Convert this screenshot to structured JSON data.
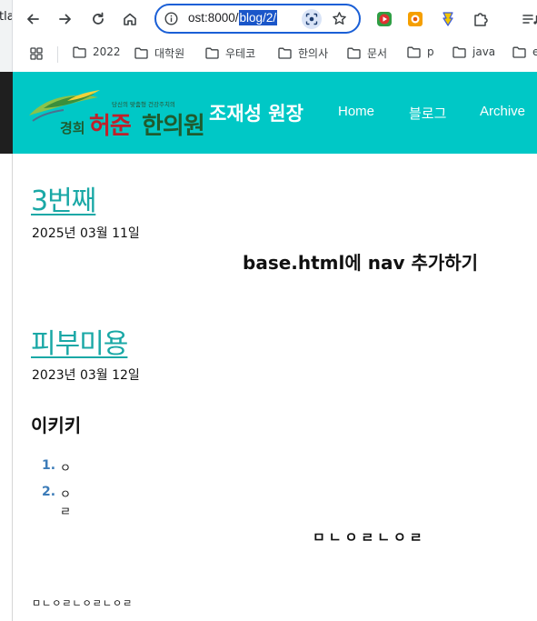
{
  "browser": {
    "tab_fragment": "tla",
    "url_visible": "ost:8000/",
    "url_selected": "blog/2/",
    "bookmarks": [
      "2022",
      "대학원",
      "우테코",
      "한의사",
      "문서",
      "p",
      "java",
      "e"
    ]
  },
  "header": {
    "logo": {
      "tagline": "당신의 맞춤형 건강주치의",
      "prefix": "경희",
      "name_red": "허준",
      "name_green": "한의원"
    },
    "site_title": "조재성 원장",
    "nav": [
      "Home",
      "블로그",
      "Archive"
    ],
    "color": "#00c8c6"
  },
  "posts": [
    {
      "title": "3번째",
      "date": "2025년 03월 11일",
      "heading": "base.html에 nav 추가하기"
    },
    {
      "title": "피부미용",
      "date": "2023년 03월 12일",
      "heading": "이키키",
      "list": [
        {
          "num": "1.",
          "text": "ㅇ"
        },
        {
          "num": "2.",
          "text": "ㅇㄹ"
        }
      ],
      "centered": "ㅁㄴㅇㄹㄴㅇㄹ",
      "small": "ㅁㄴㅇㄹㄴㅇㄹㄴㅇㄹ"
    }
  ]
}
